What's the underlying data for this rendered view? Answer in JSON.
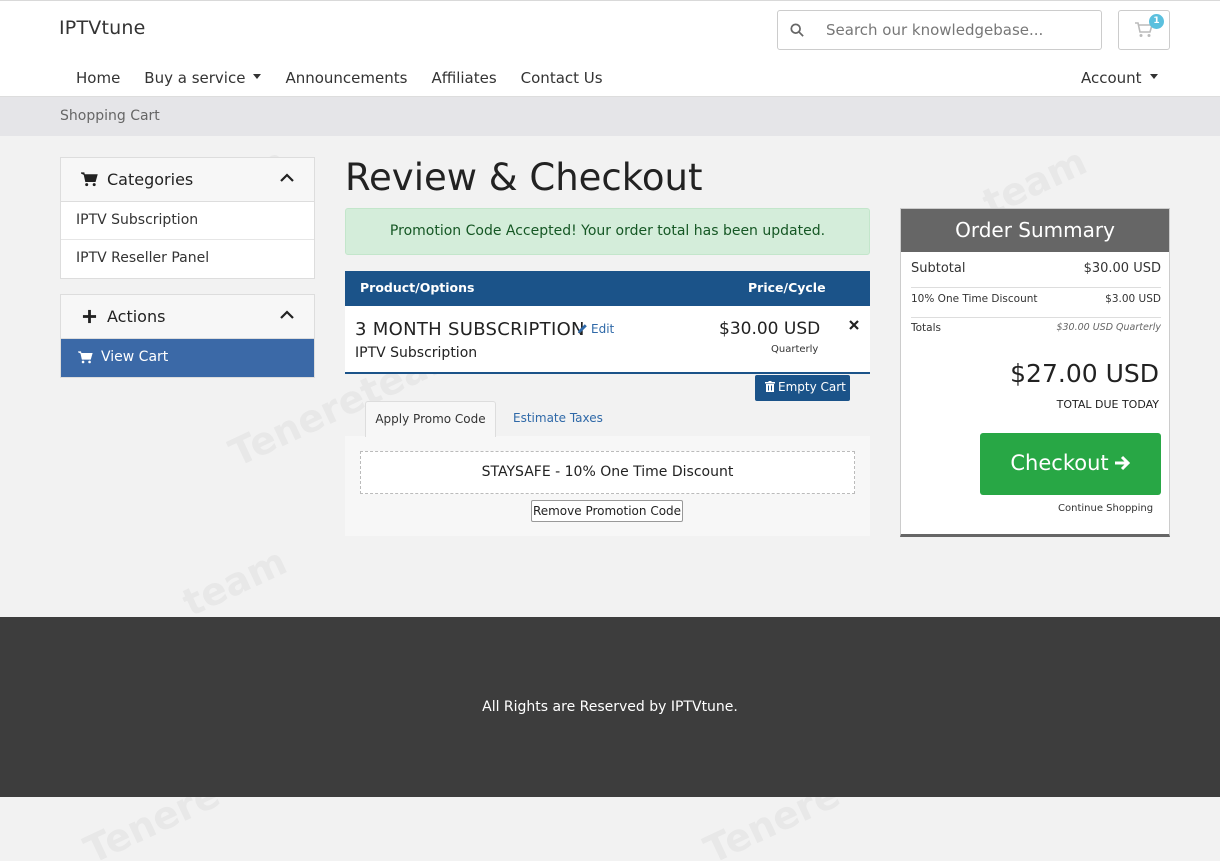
{
  "header": {
    "logo": "IPTVtune",
    "search_placeholder": "Search our knowledgebase...",
    "cart_count": "1",
    "nav": [
      "Home",
      "Buy a service",
      "Announcements",
      "Affiliates",
      "Contact Us"
    ],
    "account": "Account"
  },
  "breadcrumb": "Shopping Cart",
  "sidebar": {
    "categories": {
      "title": "Categories",
      "items": [
        "IPTV Subscription",
        "IPTV Reseller Panel"
      ]
    },
    "actions": {
      "title": "Actions",
      "items": [
        "View Cart"
      ]
    }
  },
  "main": {
    "title": "Review & Checkout",
    "alert": "Promotion Code Accepted! Your order total has been updated.",
    "table": {
      "col_product": "Product/Options",
      "col_price": "Price/Cycle",
      "product_name": "3 MONTH SUBSCRIPTION",
      "edit_label": "Edit",
      "product_group": "IPTV Subscription",
      "price": "$30.00 USD",
      "cycle": "Quarterly"
    },
    "empty_cart": "Empty Cart",
    "tabs": [
      "Apply Promo Code",
      "Estimate Taxes"
    ],
    "promo_applied": "STAYSAFE - 10% One Time Discount",
    "remove_promo": "Remove Promotion Code"
  },
  "summary": {
    "title": "Order Summary",
    "subtotal_label": "Subtotal",
    "subtotal_value": "$30.00 USD",
    "discount_label": "10% One Time Discount",
    "discount_value": "$3.00 USD",
    "totals_label": "Totals",
    "totals_value": "$30.00 USD Quarterly",
    "total_due": "$27.00 USD",
    "total_due_label": "TOTAL DUE TODAY",
    "checkout_label": "Checkout",
    "continue_label": "Continue Shopping"
  },
  "footer": {
    "text": "All Rights are Reserved by IPTVtune."
  },
  "colors": {
    "primary": "#1b5389",
    "active_sidebar": "#3b69a7",
    "checkout": "#28a745",
    "alert_bg": "#d4edda",
    "footer_bg": "#3d3d3d"
  }
}
